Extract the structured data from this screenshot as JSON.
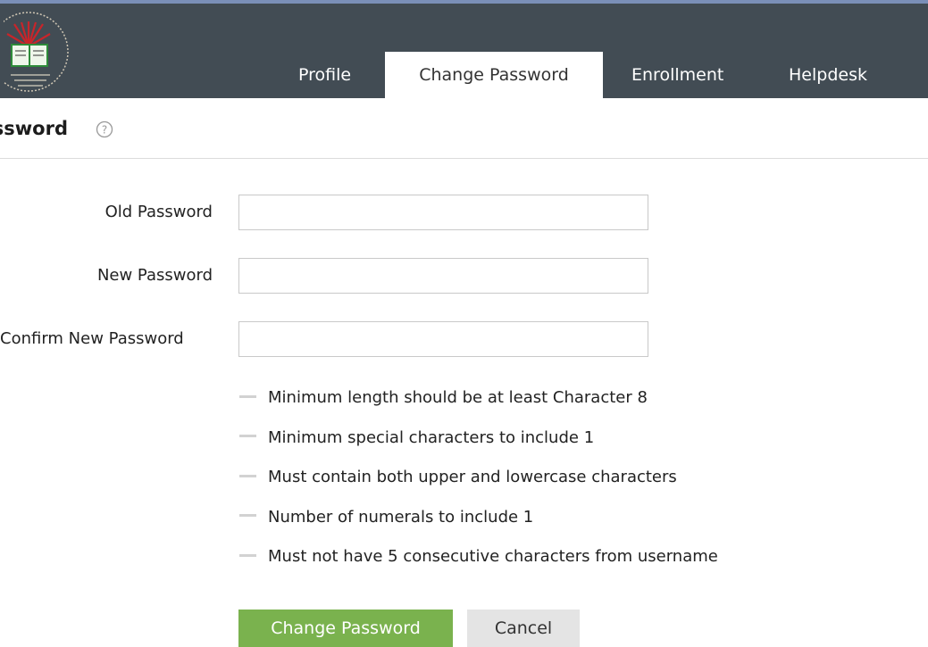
{
  "nav": {
    "tabs": [
      {
        "label": "Profile",
        "active": false
      },
      {
        "label": "Change Password",
        "active": true
      },
      {
        "label": "Enrollment",
        "active": false
      },
      {
        "label": "Helpdesk",
        "active": false
      }
    ]
  },
  "page": {
    "title": "Change Password",
    "help_icon": "question-circle-icon"
  },
  "form": {
    "fields": [
      {
        "label": "Old Password",
        "value": ""
      },
      {
        "label": "New Password",
        "value": ""
      },
      {
        "label": "Confirm New Password",
        "value": ""
      }
    ],
    "rules": [
      "Minimum length should be at least Character 8",
      "Minimum special characters to include 1",
      "Must contain both upper and lowercase characters",
      "Number of numerals to include 1",
      "Must not have 5 consecutive characters from username"
    ],
    "submit_label": "Change Password",
    "cancel_label": "Cancel"
  },
  "colors": {
    "header_bg": "#424c54",
    "header_accent": "#7a8fb8",
    "primary_button": "#7ab24e",
    "secondary_button": "#e4e4e4"
  }
}
